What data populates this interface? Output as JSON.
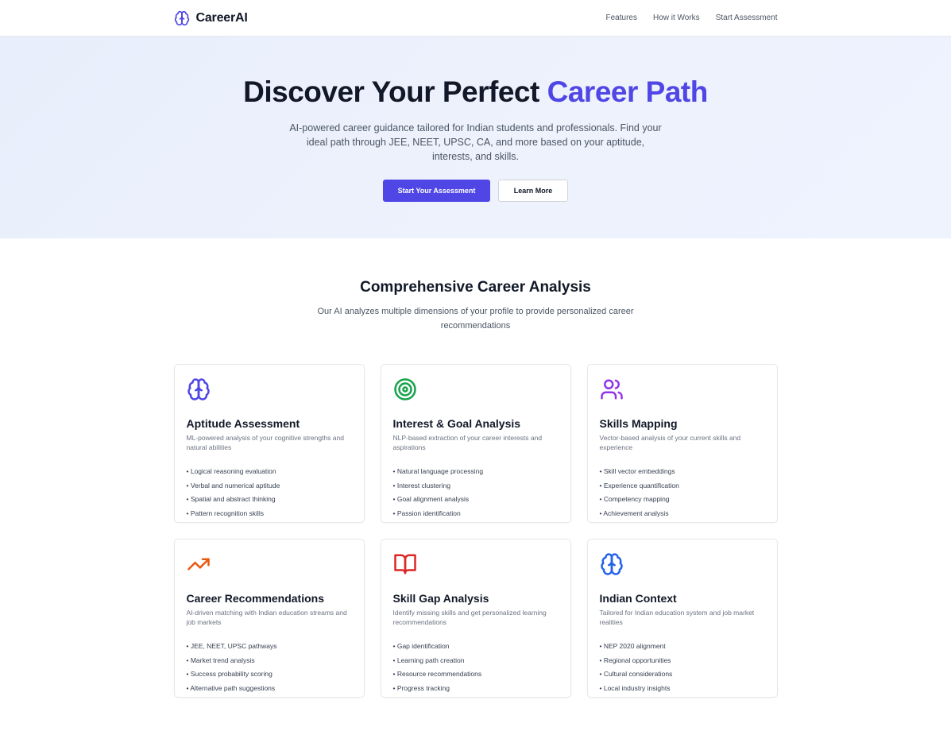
{
  "nav": {
    "brand": "CareerAI",
    "links": [
      "Features",
      "How it Works",
      "Start Assessment"
    ]
  },
  "hero": {
    "title_prefix": "Discover Your Perfect",
    "title_accent": "Career Path",
    "subtitle": "AI-powered career guidance tailored for Indian students and professionals. Find your ideal path through JEE, NEET, UPSC, CA, and more based on your aptitude, interests, and skills.",
    "primary_button": "Start Your Assessment",
    "secondary_button": "Learn More"
  },
  "features": {
    "title": "Comprehensive Career Analysis",
    "subtitle": "Our AI analyzes multiple dimensions of your profile to provide personalized career recommendations",
    "cards": [
      {
        "icon": "brain-icon",
        "icon_color": "#4f46e5",
        "title": "Aptitude Assessment",
        "description": "ML-powered analysis of your cognitive strengths and natural abilities",
        "items": [
          "• Logical reasoning evaluation",
          "• Verbal and numerical aptitude",
          "• Spatial and abstract thinking",
          "• Pattern recognition skills"
        ]
      },
      {
        "icon": "target-icon",
        "icon_color": "#16a34a",
        "title": "Interest & Goal Analysis",
        "description": "NLP-based extraction of your career interests and aspirations",
        "items": [
          "• Natural language processing",
          "• Interest clustering",
          "• Goal alignment analysis",
          "• Passion identification"
        ]
      },
      {
        "icon": "users-icon",
        "icon_color": "#9333ea",
        "title": "Skills Mapping",
        "description": "Vector-based analysis of your current skills and experience",
        "items": [
          "• Skill vector embeddings",
          "• Experience quantification",
          "• Competency mapping",
          "• Achievement analysis"
        ]
      },
      {
        "icon": "trending-up-icon",
        "icon_color": "#ea580c",
        "title": "Career Recommendations",
        "description": "AI-driven matching with Indian education streams and job markets",
        "items": [
          "• JEE, NEET, UPSC pathways",
          "• Market trend analysis",
          "• Success probability scoring",
          "• Alternative path suggestions"
        ]
      },
      {
        "icon": "book-open-icon",
        "icon_color": "#dc2626",
        "title": "Skill Gap Analysis",
        "description": "Identify missing skills and get personalized learning recommendations",
        "items": [
          "• Gap identification",
          "• Learning path creation",
          "• Resource recommendations",
          "• Progress tracking"
        ]
      },
      {
        "icon": "brain-icon",
        "icon_color": "#2563eb",
        "title": "Indian Context",
        "description": "Tailored for Indian education system and job market realities",
        "items": [
          "• NEP 2020 alignment",
          "• Regional opportunities",
          "• Cultural considerations",
          "• Local industry insights"
        ]
      }
    ]
  },
  "colors": {
    "accent": "#4f46e5",
    "hero_bg": "#eaf0fd",
    "text_dark": "#111827",
    "text_muted": "#6b7280"
  }
}
